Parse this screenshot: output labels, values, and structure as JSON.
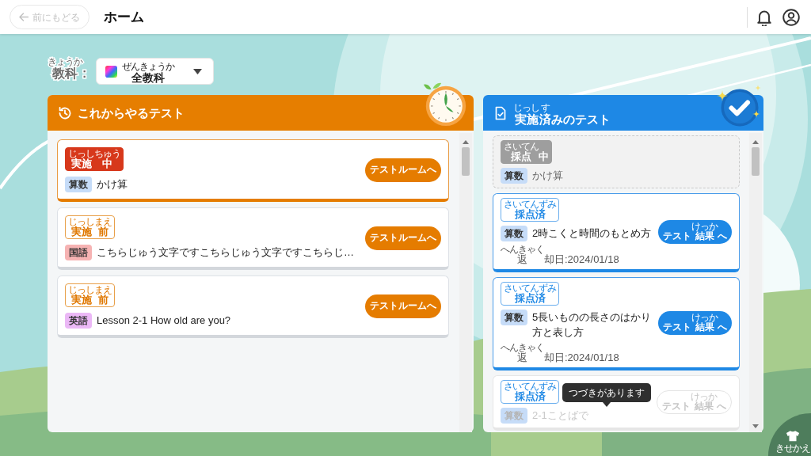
{
  "top_bar": {
    "back_button": {
      "label": "前にもどる",
      "disabled": true
    },
    "title": "ホーム"
  },
  "subject_filter": {
    "label": [
      {
        "base": "教科",
        "ruby": "きょうか"
      },
      {
        "base": ":"
      }
    ],
    "value": [
      {
        "base": "全教科",
        "ruby": "ぜんきょうか"
      }
    ]
  },
  "upcoming_tests": {
    "title": [
      {
        "base": "これからやるテスト"
      }
    ],
    "cards": [
      {
        "status": {
          "kind": "in_progress",
          "label": [
            {
              "base": "実施",
              "ruby": "じっし"
            },
            {
              "base": "中",
              "ruby": "ちゅう"
            }
          ]
        },
        "subject": {
          "label": "算数",
          "color": "#c6dcf8"
        },
        "title": "かけ算",
        "button": {
          "label": [
            {
              "base": "テストルームへ"
            }
          ],
          "disabled": false
        }
      },
      {
        "status": {
          "kind": "not_started",
          "label": [
            {
              "base": "実施",
              "ruby": "じっし"
            },
            {
              "base": "前",
              "ruby": "まえ"
            }
          ]
        },
        "subject": {
          "label": "国語",
          "color": "#f6b3b3"
        },
        "title": "こちらじゅう文字ですこちらじゅう文字ですこちらじ…",
        "button": {
          "label": [
            {
              "base": "テストルームへ"
            }
          ],
          "disabled": false
        }
      },
      {
        "status": {
          "kind": "not_started",
          "label": [
            {
              "base": "実施",
              "ruby": "じっし"
            },
            {
              "base": "前",
              "ruby": "まえ"
            }
          ]
        },
        "subject": {
          "label": "英語",
          "color": "#ebb8f6"
        },
        "title": "Lesson 2-1 How old are you?",
        "button": {
          "label": [
            {
              "base": "テストルームへ"
            }
          ],
          "disabled": false
        }
      }
    ]
  },
  "completed_tests": {
    "title": [
      {
        "base": "実施",
        "ruby": "じっし"
      },
      {
        "base": "済",
        "ruby": "す"
      },
      {
        "base": "みのテスト"
      }
    ],
    "cards": [
      {
        "status": {
          "kind": "grading",
          "label": [
            {
              "base": "採点",
              "ruby": "さいてん"
            },
            {
              "base": "中"
            }
          ]
        },
        "subject": {
          "label": "算数",
          "color": "#c6dcf8"
        },
        "title": "かけ算",
        "faded": false
      },
      {
        "status": {
          "kind": "graded",
          "label": [
            {
              "base": "採点済",
              "ruby": "さいてんずみ"
            }
          ]
        },
        "subject": {
          "label": "算数",
          "color": "#c6dcf8"
        },
        "title": "2時こくと時間のもとめ方",
        "button": {
          "label": [
            {
              "base": "テスト"
            },
            {
              "base": "結果",
              "ruby": "けっか"
            },
            {
              "base": "へ"
            }
          ],
          "disabled": false
        },
        "return_date": [
          {
            "base": "返",
            "ruby": "へんきゃく"
          },
          {
            "base": "却日:2024/01/18"
          }
        ],
        "faded": false
      },
      {
        "status": {
          "kind": "graded",
          "label": [
            {
              "base": "採点済",
              "ruby": "さいてんずみ"
            }
          ]
        },
        "subject": {
          "label": "算数",
          "color": "#c6dcf8"
        },
        "title": "5長いものの長さのはかり方と表し方",
        "button": {
          "label": [
            {
              "base": "テスト"
            },
            {
              "base": "結果",
              "ruby": "けっか"
            },
            {
              "base": "へ"
            }
          ],
          "disabled": false
        },
        "return_date": [
          {
            "base": "返",
            "ruby": "へんきゃく"
          },
          {
            "base": "却日:2024/01/18"
          }
        ],
        "faded": false
      },
      {
        "status": {
          "kind": "graded",
          "label": [
            {
              "base": "採点済",
              "ruby": "さいてんずみ"
            }
          ]
        },
        "subject": {
          "label": "算数",
          "color": "#c6dcf8"
        },
        "title": "2-1ことばで",
        "button": {
          "label": [
            {
              "base": "テスト"
            },
            {
              "base": "結果",
              "ruby": "けっか"
            },
            {
              "base": "へ"
            }
          ],
          "disabled": true
        },
        "faded": true
      }
    ],
    "tooltip": "つづきがあります"
  },
  "dress_up_button": "きせかえ"
}
